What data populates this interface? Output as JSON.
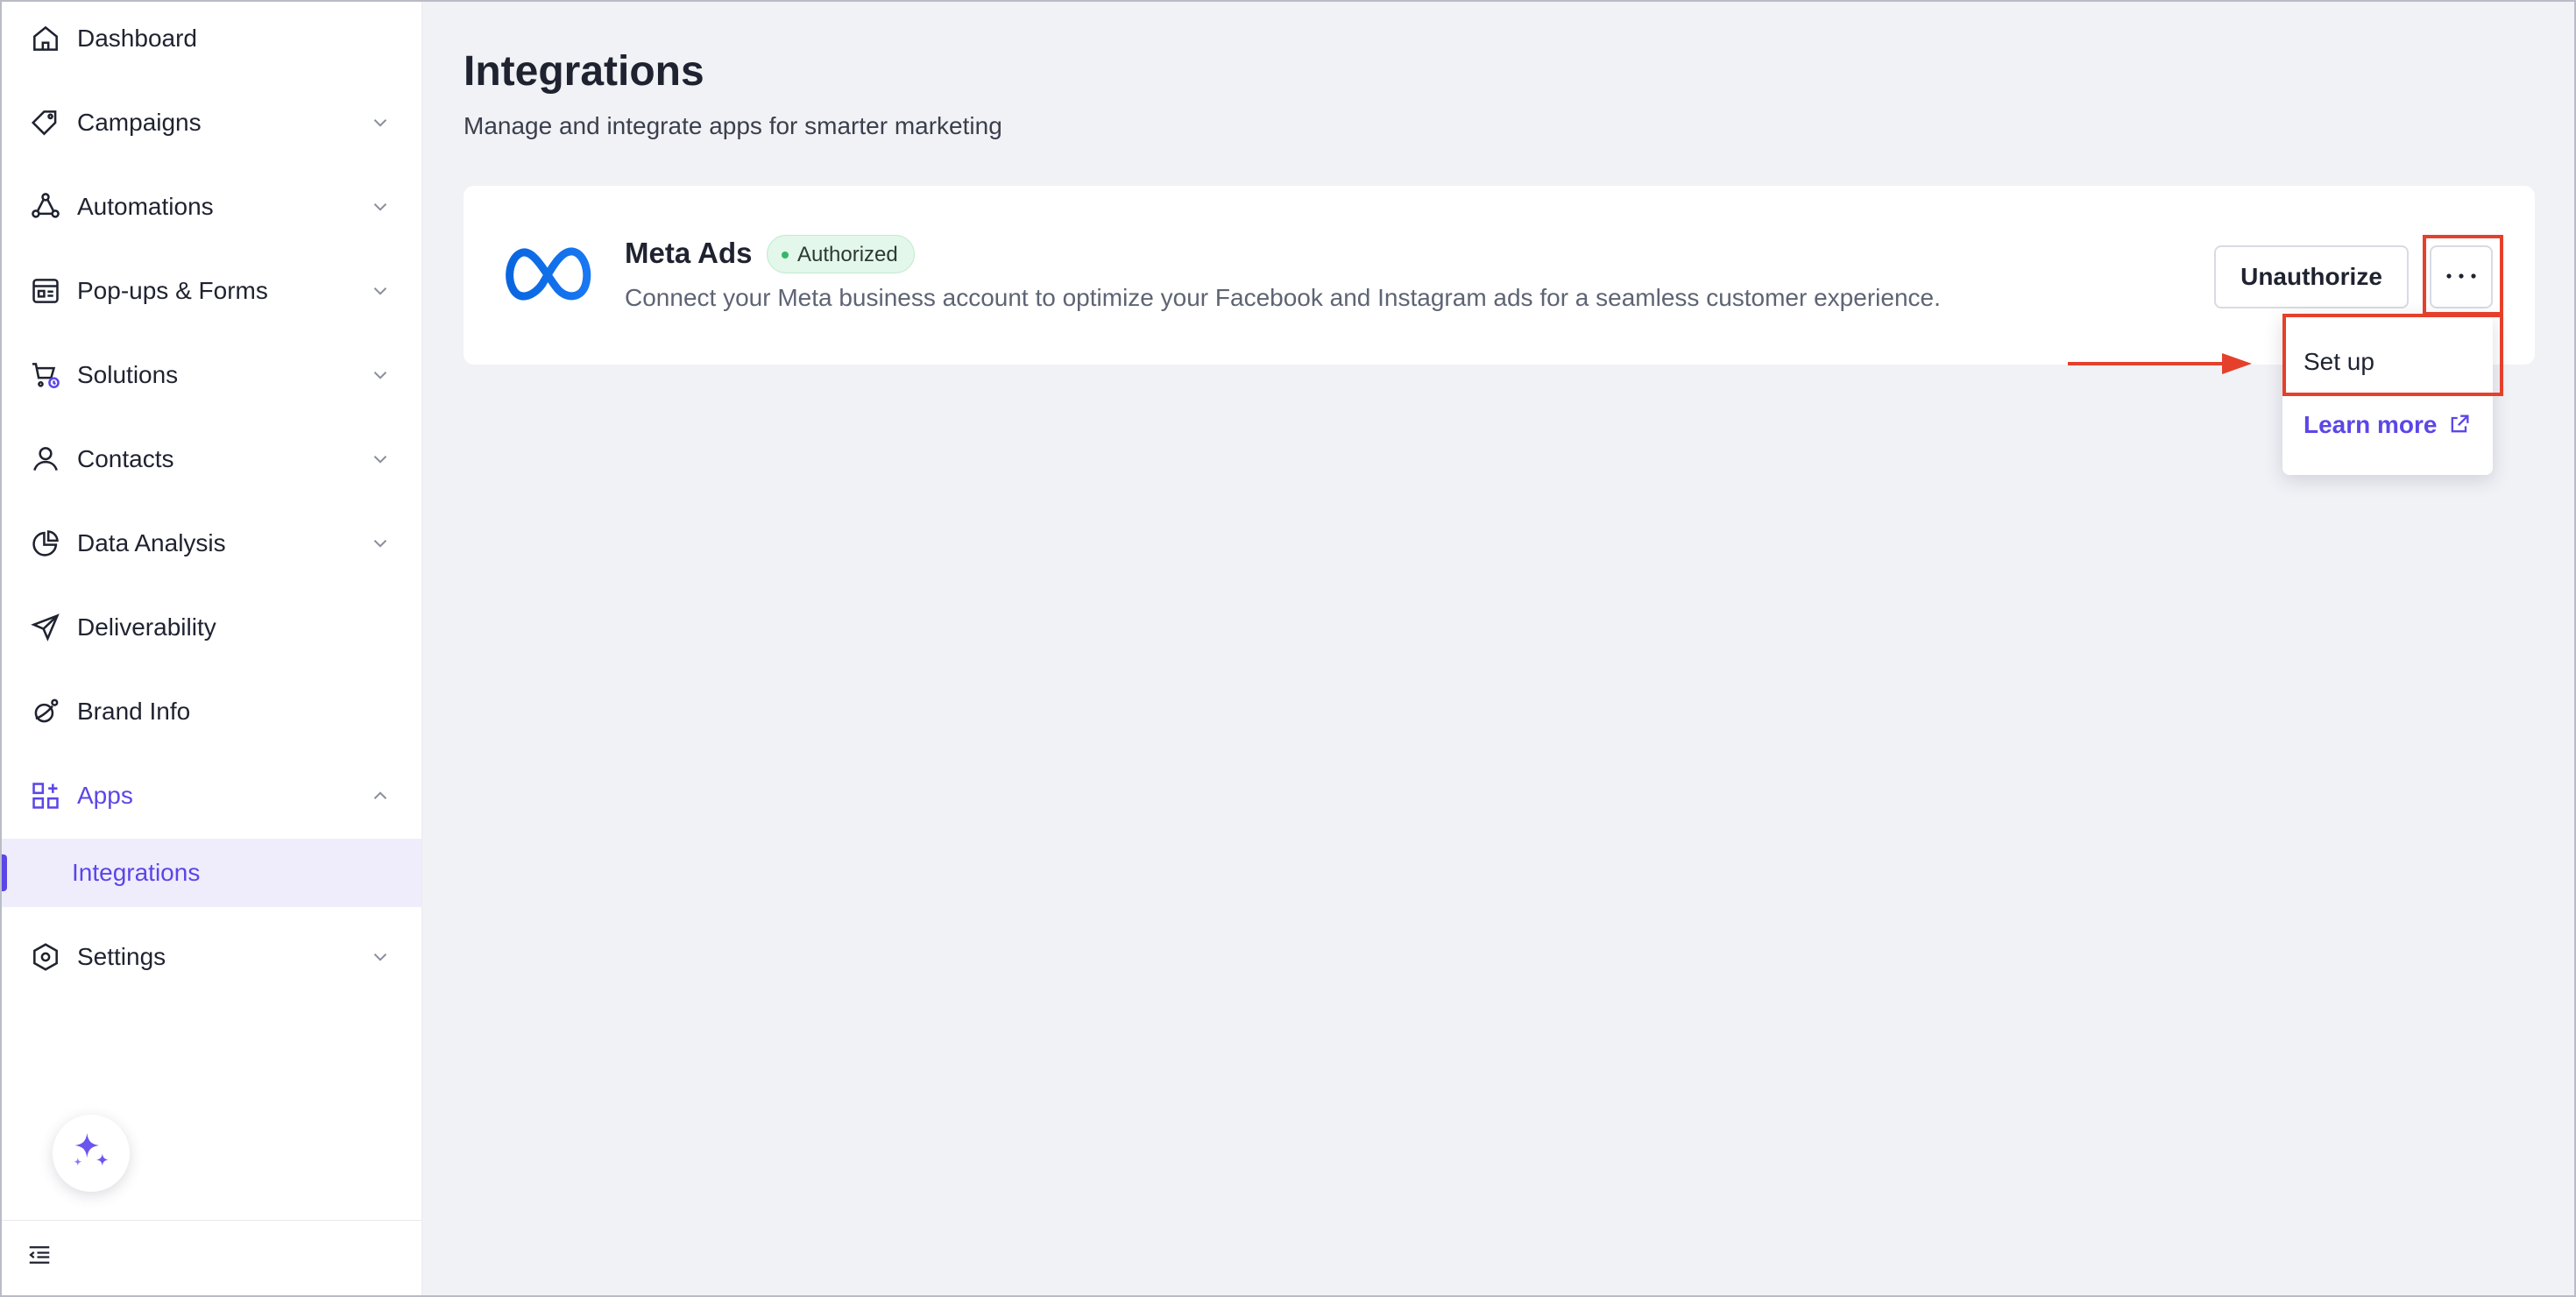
{
  "sidebar": {
    "items": [
      {
        "label": "Dashboard",
        "icon": "home-icon"
      },
      {
        "label": "Campaigns",
        "icon": "tag-icon"
      },
      {
        "label": "Automations",
        "icon": "automation-icon"
      },
      {
        "label": "Pop-ups & Forms",
        "icon": "form-icon"
      },
      {
        "label": "Solutions",
        "icon": "cart-icon"
      },
      {
        "label": "Contacts",
        "icon": "user-icon"
      },
      {
        "label": "Data Analysis",
        "icon": "pie-chart-icon"
      },
      {
        "label": "Deliverability",
        "icon": "send-icon"
      },
      {
        "label": "Brand Info",
        "icon": "brand-icon"
      },
      {
        "label": "Apps",
        "icon": "apps-grid-icon"
      },
      {
        "label": "Settings",
        "icon": "settings-hex-icon"
      }
    ],
    "subitem": {
      "label": "Integrations"
    }
  },
  "page": {
    "title": "Integrations",
    "subtitle": "Manage and integrate apps for smarter marketing"
  },
  "integration": {
    "name": "Meta Ads",
    "status": "Authorized",
    "description": "Connect your Meta business account to optimize your Facebook and Instagram ads for a seamless customer experience.",
    "unauthorize_label": "Unauthorize",
    "more_label": "···"
  },
  "dropdown": {
    "setup_label": "Set up",
    "learn_more_label": "Learn more"
  },
  "colors": {
    "accent": "#5b46e8",
    "highlight": "#e5402b",
    "status_green": "#34b86a",
    "meta_blue": "#1877f2"
  }
}
